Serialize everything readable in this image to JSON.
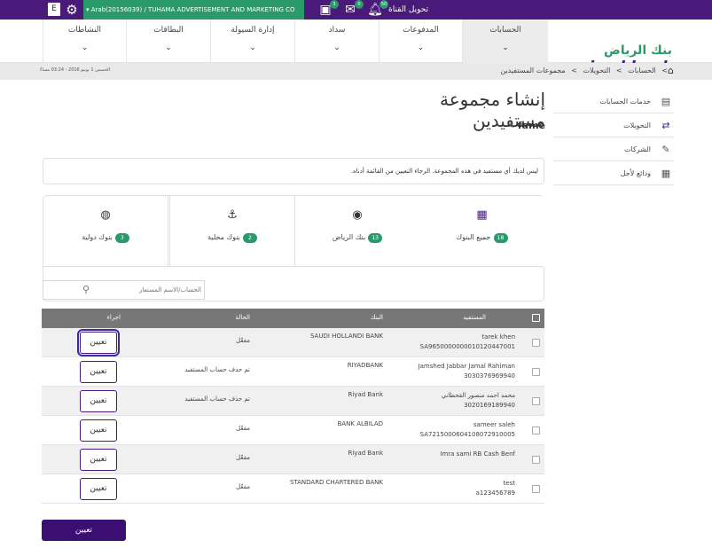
{
  "topbar": {
    "lang_label": "E",
    "account_label": "Arab(20156039) / TUHAMA ADVERTISEMENT AND MARKETING CO",
    "messages_badge": "3",
    "mail_badge": "0",
    "notifications_badge": "50",
    "switch_channel": "تحويل القناة"
  },
  "nav": {
    "items": [
      {
        "label": "الحسابات"
      },
      {
        "label": "المدفوعات"
      },
      {
        "label": "سداد"
      },
      {
        "label": "إدارة السيولة"
      },
      {
        "label": "البطاقات"
      },
      {
        "label": "النشاطات"
      }
    ]
  },
  "logo": {
    "arabic": "بنك الرياض",
    "english": "riyad bank"
  },
  "breadcrumb": {
    "items": [
      "الحسابات",
      "التحويلات",
      "مجموعات المستفيدين"
    ],
    "separator": ">",
    "date": "الخميس 1 يونيو 2016 - 03:24 مساءً"
  },
  "sidebar": {
    "items": [
      {
        "label": "خدمات الحسابات",
        "icon": "wallet-icon"
      },
      {
        "label": "التحويلات",
        "icon": "transfer-icon"
      },
      {
        "label": "الشركات",
        "icon": "company-icon"
      },
      {
        "label": "ودائع لأجل",
        "icon": "deposit-icon"
      }
    ]
  },
  "page": {
    "title": "إنشاء مجموعة مستفيدين",
    "group_name": "fame",
    "notice": "ليس لديك أي مستفيد في هذه المجموعة. الرجاء التعيين من القائمة أدناه."
  },
  "tabs": [
    {
      "label": "جميع البنوك",
      "count": "18",
      "icon": "all-banks-icon"
    },
    {
      "label": "بنك الرياض",
      "count": "13",
      "icon": "riyad-bank-icon"
    },
    {
      "label": "بنوك محلية",
      "count": "2",
      "icon": "local-banks-icon"
    },
    {
      "label": "بنوك دولية",
      "count": "3",
      "icon": "international-banks-icon"
    }
  ],
  "search": {
    "placeholder": "الحساب/الاسم المستعار"
  },
  "table": {
    "headers": {
      "beneficiary": "المستفيد",
      "bank": "البنك",
      "status": "الحالة",
      "action": "اجراء"
    },
    "rows": [
      {
        "name": "tarek khen",
        "account": "SA9650000000010120447001",
        "bank": "SAUDI HOLLANDI BANK",
        "status": "مفعّل",
        "action": "تعيين"
      },
      {
        "name": "Jamshed Jabbar Jamal Rahiman",
        "account": "3030376969940",
        "bank": "RIYADBANK",
        "status": "تم حذف حساب المستفيد",
        "action": "تعيين"
      },
      {
        "name": "محمد احمد منصور القحطاني",
        "account": "3020169189940",
        "bank": "Riyad Bank",
        "status": "تم حذف حساب المستفيد",
        "action": "تعيين"
      },
      {
        "name": "sameer saleh",
        "account": "SA7215000604108072910005",
        "bank": "BANK ALBILAD",
        "status": "مفعّل",
        "action": "تعيين"
      },
      {
        "name": "Imra sami RB Cash Benf",
        "account": "",
        "bank": "Riyad Bank",
        "status": "مفعّل",
        "action": "تعيين"
      },
      {
        "name": "test",
        "account": "a123456789",
        "bank": "STANDARD CHARTERED BANK",
        "status": "مفعّل",
        "action": "تعيين"
      }
    ]
  },
  "footer": {
    "assign_label": "تعيين"
  }
}
